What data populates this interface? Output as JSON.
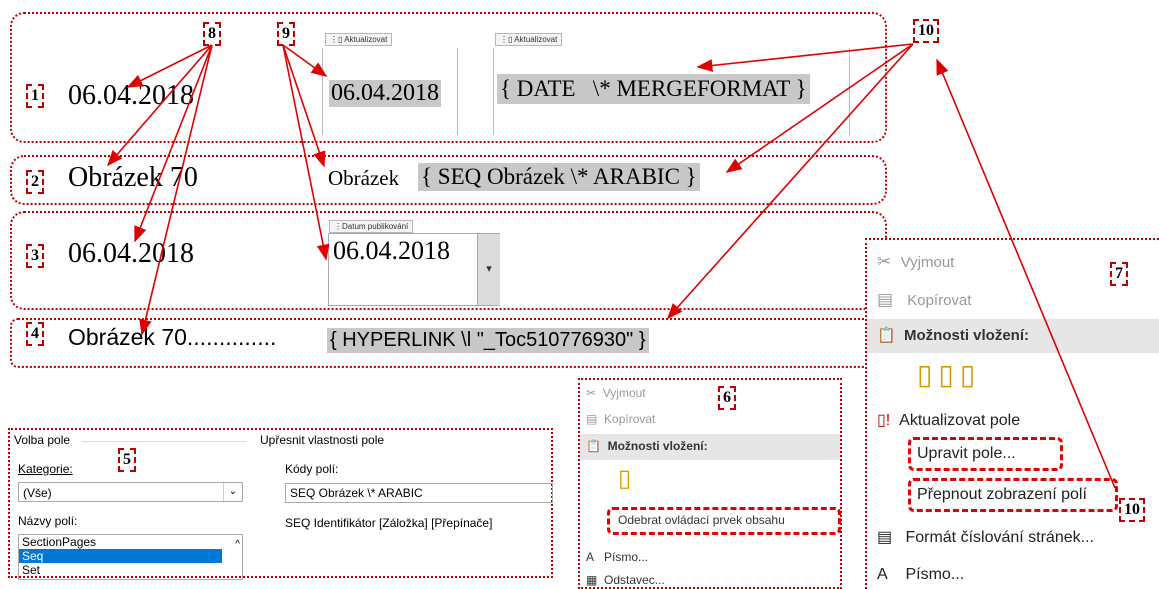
{
  "callouts": {
    "n1": "1",
    "n2": "2",
    "n3": "3",
    "n4": "4",
    "n5": "5",
    "n6": "6",
    "n7": "7",
    "n8": "8",
    "n9": "9",
    "n10a": "10",
    "n10b": "10"
  },
  "row1": {
    "date": "06.04.2018",
    "tag1": "Aktualizovat",
    "field_value": "06.04.2018",
    "tag2": "Aktualizovat",
    "field_code": "{ DATE   \\* MERGEFORMAT }"
  },
  "row2": {
    "label": "Obrázek 70",
    "prefix": "Obrázek",
    "field_code": "{ SEQ Obrázek \\* ARABIC }"
  },
  "row3": {
    "date": "06.04.2018",
    "tag": "Datum publikování",
    "control_value": "06.04.2018",
    "dropdown_arrow": "▾"
  },
  "row4": {
    "label": "Obrázek 70",
    "dots": "..............",
    "field_code": "{ HYPERLINK \\l \"_Toc510776930\" }"
  },
  "dialog": {
    "group_left": "Volba pole",
    "category_label": "Kategorie:",
    "category_value": "(Vše)",
    "names_label": "Názvy polí:",
    "names": [
      "SectionPages",
      "Seq",
      "Set"
    ],
    "group_right": "Upřesnit vlastnosti pole",
    "codes_label": "Kódy polí:",
    "codes_value": "SEQ Obrázek \\* ARABIC",
    "syntax": "SEQ Identifikátor [Záložka] [Přepínače]"
  },
  "menu_small": {
    "cut": "Vyjmout",
    "copy": "Kopírovat",
    "paste_header": "Možnosti vložení:",
    "remove_control": "Odebrat ovládací prvek obsahu",
    "font": "Písmo...",
    "paragraph": "Odstavec..."
  },
  "menu_large": {
    "cut": "Vyjmout",
    "copy": "Kopírovat",
    "paste_header": "Možnosti vložení:",
    "update": "Aktualizovat pole",
    "edit": "Upravit pole...",
    "toggle": "Přepnout zobrazení polí",
    "page_format": "Formát číslování stránek...",
    "font": "Písmo..."
  },
  "icons": [
    "scissors-icon",
    "copy-icon",
    "clipboard-icon",
    "update-field-icon",
    "page-number-icon",
    "font-icon"
  ],
  "colors": {
    "callout_red": "#c00000",
    "arrow_red": "#e00000",
    "highlight": "#c8c8c8",
    "hyperlink_blue": "#1f5fa6",
    "selection": "#0078d7"
  }
}
